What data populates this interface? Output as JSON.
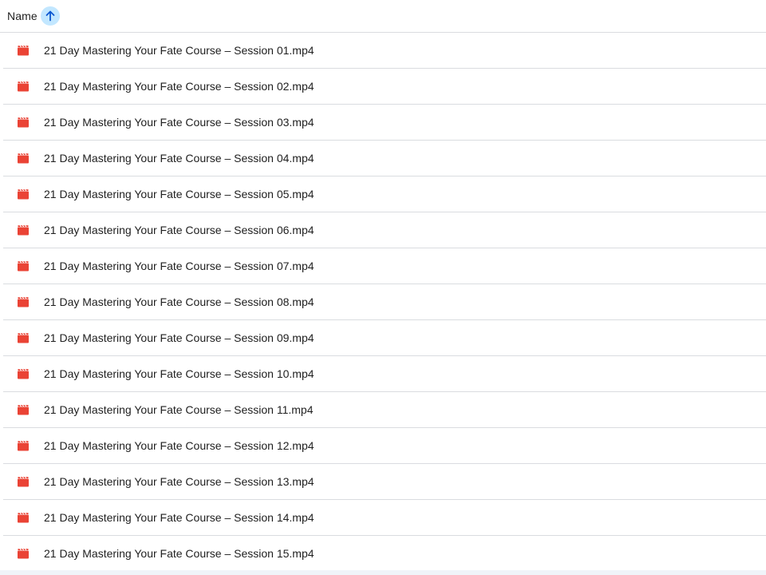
{
  "header": {
    "column_label": "Name",
    "sort_icon": "arrow-up-icon",
    "sort_direction": "ascending"
  },
  "file_icon": "video-file-icon",
  "colors": {
    "video_icon": "#ea4335",
    "sort_button_bg": "#c2e7ff",
    "sort_arrow": "#0b57d0",
    "divider": "#dadce0"
  },
  "files": [
    {
      "name": "21 Day Mastering Your Fate Course – Session 01.mp4"
    },
    {
      "name": "21 Day Mastering Your Fate Course – Session 02.mp4"
    },
    {
      "name": "21 Day Mastering Your Fate Course – Session 03.mp4"
    },
    {
      "name": "21 Day Mastering Your Fate Course – Session 04.mp4"
    },
    {
      "name": "21 Day Mastering Your Fate Course – Session 05.mp4"
    },
    {
      "name": "21 Day Mastering Your Fate Course – Session 06.mp4"
    },
    {
      "name": "21 Day Mastering Your Fate Course – Session 07.mp4"
    },
    {
      "name": "21 Day Mastering Your Fate Course – Session 08.mp4"
    },
    {
      "name": "21 Day Mastering Your Fate Course – Session 09.mp4"
    },
    {
      "name": "21 Day Mastering Your Fate Course – Session 10.mp4"
    },
    {
      "name": "21 Day Mastering Your Fate Course – Session 11.mp4"
    },
    {
      "name": "21 Day Mastering Your Fate Course – Session 12.mp4"
    },
    {
      "name": "21 Day Mastering Your Fate Course – Session 13.mp4"
    },
    {
      "name": "21 Day Mastering Your Fate Course – Session 14.mp4"
    },
    {
      "name": "21 Day Mastering Your Fate Course – Session 15.mp4"
    }
  ]
}
